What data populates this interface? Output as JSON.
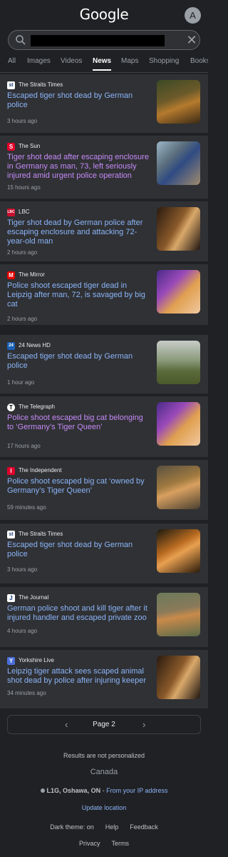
{
  "header": {
    "logo": "Google",
    "avatar": "A"
  },
  "search": {
    "clear": "✕"
  },
  "tabs": [
    "All",
    "Images",
    "Videos",
    "News",
    "Maps",
    "Shopping",
    "Books"
  ],
  "articles": [
    {
      "source": "The Straits Times",
      "favicon": "st",
      "title": "Escaped tiger shot dead by German police",
      "time": "3 hours ago"
    },
    {
      "source": "The Sun",
      "favicon": "S",
      "title": "Tiger shot dead after escaping enclosure in Germany as man, 73, left seriously injured amid urgent police operation",
      "time": "15 hours ago"
    },
    {
      "source": "LBC",
      "favicon": "LBC",
      "title": "Tiger shot dead by German police after escaping enclosure and attacking 72-year-old man",
      "time": "2 hours ago"
    },
    {
      "source": "The Mirror",
      "favicon": "M",
      "title": "Police shoot escaped tiger dead in Leipzig after man, 72, is savaged by big cat",
      "time": "2 hours ago"
    },
    {
      "source": "24 News HD",
      "favicon": "24",
      "title": "Escaped tiger shot dead by German police",
      "time": "1 hour ago"
    },
    {
      "source": "The Telegraph",
      "favicon": "T",
      "title": "Police shoot escaped big cat belonging to ‘Germany’s Tiger Queen’",
      "time": "17 hours ago"
    },
    {
      "source": "The Independent",
      "favicon": "I",
      "title": "Police shoot escaped big cat ‘owned by Germany’s Tiger Queen’",
      "time": "59 minutes ago"
    },
    {
      "source": "The Straits Times",
      "favicon": "st",
      "title": "Escaped tiger shot dead by German police",
      "time": "3 hours ago"
    },
    {
      "source": "The Journal",
      "favicon": "J",
      "title": "German police shoot and kill tiger after it injured handler and escaped private zoo",
      "time": "4 hours ago"
    },
    {
      "source": "Yorkshire Live",
      "favicon": "Y",
      "title": "Leipzig tiger attack sees scaped animal shot dead by police after injuring keeper",
      "time": "34 minutes ago"
    }
  ],
  "pager": {
    "prev": "‹",
    "label": "Page 2",
    "next": "›"
  },
  "footer": {
    "not_personalized": "Results are not personalized",
    "country": "Canada",
    "location": "L1G, Oshawa, ON",
    "location_sep": " - ",
    "location_source": "From your IP address",
    "update_location": "Update location",
    "dark_theme": "Dark theme: on",
    "help": "Help",
    "feedback": "Feedback",
    "privacy": "Privacy",
    "terms": "Terms"
  },
  "colors": {
    "background": "#202124",
    "card": "#303134",
    "link": "#8ab4f8",
    "visited": "#c58af9"
  }
}
